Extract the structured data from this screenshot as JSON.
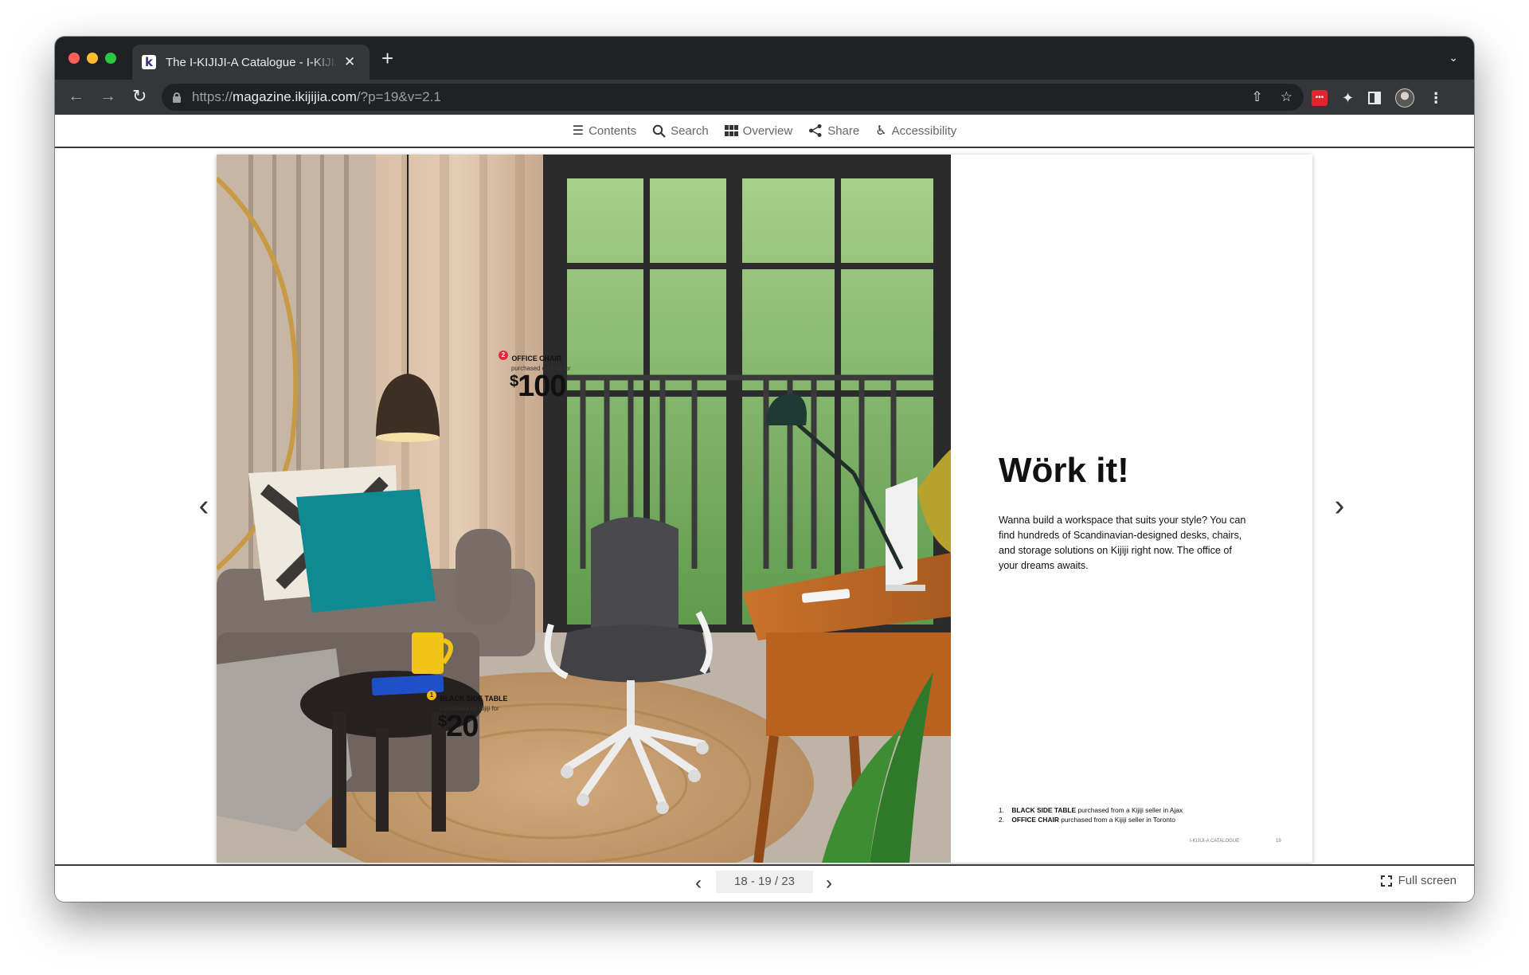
{
  "browser": {
    "tab_title": "The I-KIJIJI-A Catalogue - I-KIJIJI-A",
    "favicon_letter": "k",
    "tab_close_icon": "✕",
    "new_tab_icon": "+",
    "url_scheme": "https://",
    "url_host": "magazine.ikijijia.com",
    "url_path": "/?p=19&v=2.1"
  },
  "reader_nav": {
    "contents": "Contents",
    "search": "Search",
    "overview": "Overview",
    "share": "Share",
    "accessibility": "Accessibility"
  },
  "left_page": {
    "tag_chair": {
      "number": "2",
      "name": "OFFICE CHAIR",
      "sub": "purchased on Kijiji for",
      "currency": "$",
      "price": "100",
      "color": "#e32b3b"
    },
    "tag_table": {
      "number": "1",
      "name": "BLACK SIDE TABLE",
      "sub": "purchased on Kijiji for",
      "currency": "$",
      "price": "20",
      "color": "#f2b81c"
    }
  },
  "right_page": {
    "headline": "Wörk it!",
    "body": "Wanna build a workspace that suits your style? You can find hundreds of Scandinavian-designed desks, chairs, and storage solutions on Kijiji right now. The office of your dreams awaits.",
    "credit1_num": "1.",
    "credit1_bold": "BLACK SIDE TABLE",
    "credit1_rest": " purchased from a Kijiji seller in Ajax",
    "credit2_num": "2.",
    "credit2_bold": "OFFICE CHAIR",
    "credit2_rest": " purchased from a Kijiji seller in Toronto",
    "footer_catalogue": "I-KIJIJI-A CATALOGUE",
    "footer_page": "19"
  },
  "pagination": {
    "indicator": "18 - 19 / 23",
    "fullscreen": "Full screen"
  }
}
